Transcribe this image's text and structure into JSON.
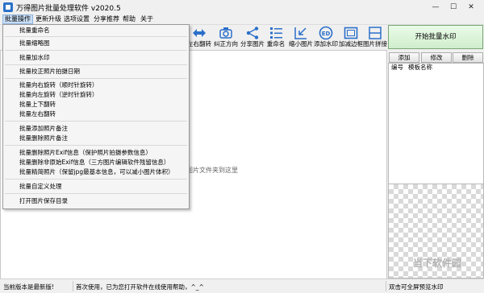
{
  "window": {
    "title": "万得图片批量处理软件 v2020.5",
    "minimize": "—",
    "maximize": "☐",
    "close": "✕"
  },
  "menubar": [
    "批量操作",
    "更新升级",
    "选项设置",
    "分享推荐",
    "帮助",
    "关于"
  ],
  "toolbar": [
    {
      "label": "左右翻转",
      "icon": "flip-horizontal-icon"
    },
    {
      "label": "纠正方向",
      "icon": "correct-orientation-icon"
    },
    {
      "label": "分享图片",
      "icon": "share-icon"
    },
    {
      "label": "重命名",
      "icon": "rename-list-icon"
    },
    {
      "label": "缩小图片",
      "icon": "shrink-icon"
    },
    {
      "label": "添加水印",
      "icon": "watermark-icon"
    },
    {
      "label": "加减边框",
      "icon": "border-icon"
    },
    {
      "label": "图片拼接",
      "icon": "stitch-icon"
    }
  ],
  "right_panel": {
    "start_button": "开始批量水印",
    "add_button": "添加",
    "edit_button": "修改",
    "delete_button": "删除",
    "col_number": "编号",
    "col_template": "模板名称"
  },
  "main": {
    "drop_hint": "图片文件夹到这里"
  },
  "dropdown": [
    "批量重命名",
    "批量缩略图",
    "批量加水印",
    "批量校正照片拍摄日期",
    "批量向右旋转（顺时针旋转）",
    "批量向左旋转（逆时针旋转）",
    "批量上下翻转",
    "批量左右翻转",
    "批量添加照片备注",
    "批量删除照片备注",
    "批量删除照片Exif信息（保护照片拍摄参数信息）",
    "批量删除非原始Exif信息（三方图片编辑软件残留信息）",
    "批量精简照片（保留jpg最基本信息，可以减小图片体积）",
    "批量自定义处理",
    "打开图片保存目录"
  ],
  "statusbar": {
    "left": "当前版本是最新版!",
    "middle": "首次使用，已为您打开软件在线使用帮助，^_^",
    "right": "双击可全屏预览水印"
  },
  "watermark_text": "当下软件园"
}
